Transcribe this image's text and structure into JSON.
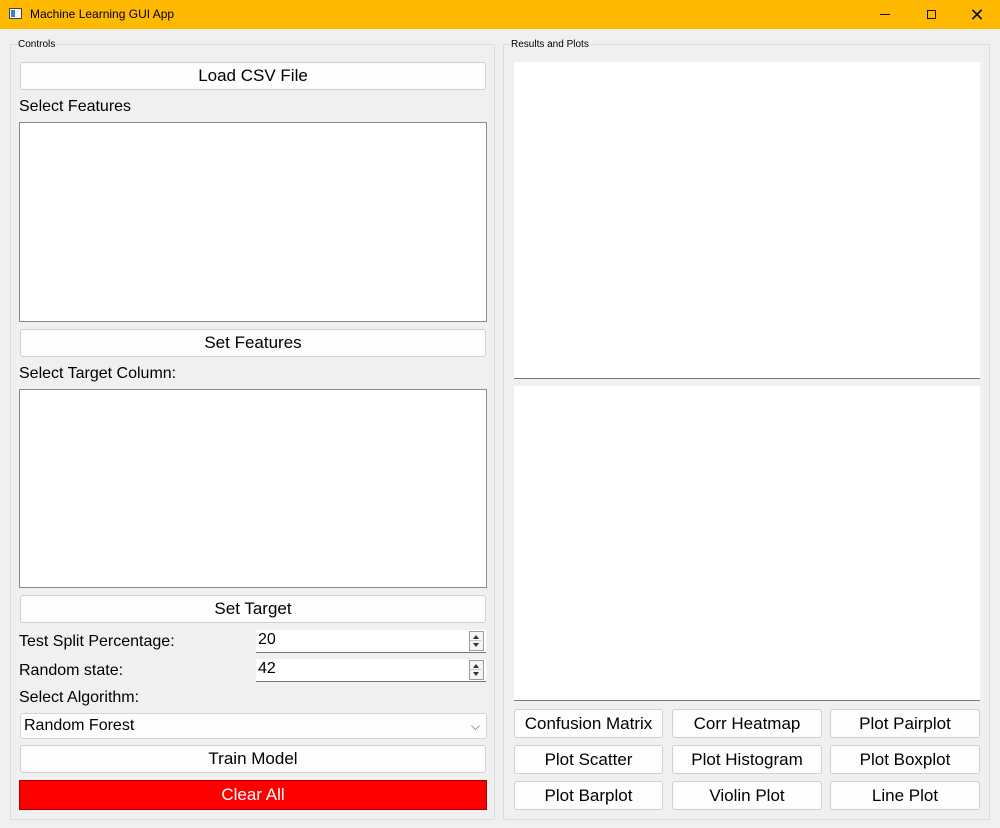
{
  "window": {
    "title": "Machine Learning GUI App",
    "icons": {
      "minimize": "minimize-icon",
      "maximize": "maximize-icon",
      "close": "close-icon"
    },
    "close_glyph": "✕",
    "accent_color": "#ffb900"
  },
  "controls": {
    "group_title": "Controls",
    "load_csv_label": "Load CSV File",
    "select_features_label": "Select Features",
    "set_features_label": "Set Features",
    "select_target_label": "Select Target Column:",
    "set_target_label": "Set Target",
    "test_split_label": "Test Split Percentage:",
    "test_split_value": "20",
    "random_state_label": "Random state:",
    "random_state_value": "42",
    "select_algorithm_label": "Select Algorithm:",
    "algorithm_selected": "Random Forest",
    "chevron_glyph": "⌵",
    "train_label": "Train Model",
    "clear_label": "Clear All",
    "clear_color": "#ff0000"
  },
  "results": {
    "group_title": "Results and Plots",
    "plot_buttons": [
      "Confusion Matrix",
      "Corr Heatmap",
      "Plot Pairplot",
      "Plot Scatter",
      "Plot Histogram",
      "Plot Boxplot",
      "Plot Barplot",
      "Violin Plot",
      "Line Plot"
    ]
  }
}
